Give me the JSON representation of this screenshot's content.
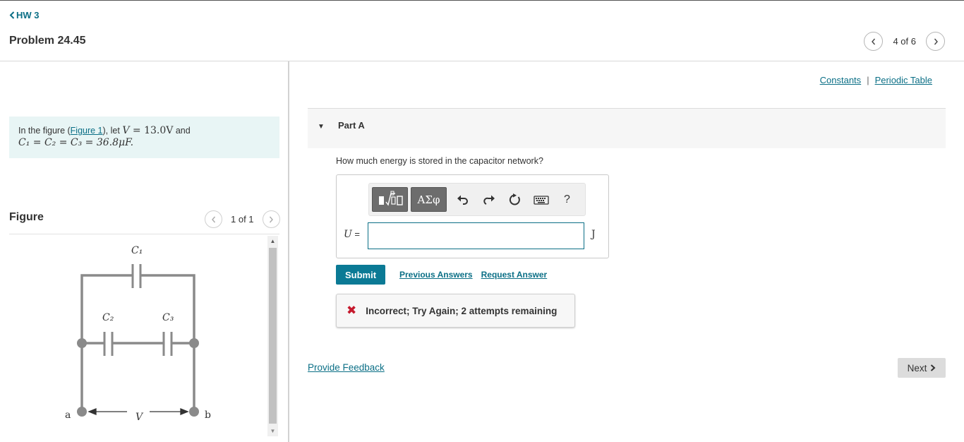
{
  "header": {
    "back_label": "HW 3",
    "problem_title": "Problem 24.45",
    "pager_text": "4 of 6"
  },
  "intro": {
    "prefix": "In the figure (",
    "figure_link": "Figure 1",
    "mid": "), let ",
    "v_sym": "V",
    "v_eq": " = 13.0V",
    "and": " and",
    "c_eq": "C₁ = C₂ = C₃ = 36.8μF."
  },
  "figure": {
    "label": "Figure",
    "count": "1 of 1",
    "labels": {
      "c1": "C₁",
      "c2": "C₂",
      "c3": "C₃",
      "a": "a",
      "b": "b",
      "v": "V"
    }
  },
  "links": {
    "constants": "Constants",
    "separator": "|",
    "periodic_table": "Periodic Table"
  },
  "part": {
    "title": "Part A",
    "question": "How much energy is stored in the capacitor network?",
    "input_label": "U",
    "input_eq": " =",
    "input_value": "",
    "unit": "J",
    "toolbar": {
      "greek_label": "ΑΣφ",
      "help_label": "?"
    },
    "submit_label": "Submit",
    "previous_answers": "Previous Answers",
    "request_answer": "Request Answer",
    "feedback_icon": "✖",
    "feedback_msg": "Incorrect; Try Again; 2 attempts remaining"
  },
  "footer": {
    "provide_feedback": "Provide Feedback",
    "next_label": "Next"
  },
  "colors": {
    "accent": "#0b6f86",
    "submit": "#0b7a95",
    "error": "#c5192d",
    "intro_bg": "#e8f5f5"
  }
}
